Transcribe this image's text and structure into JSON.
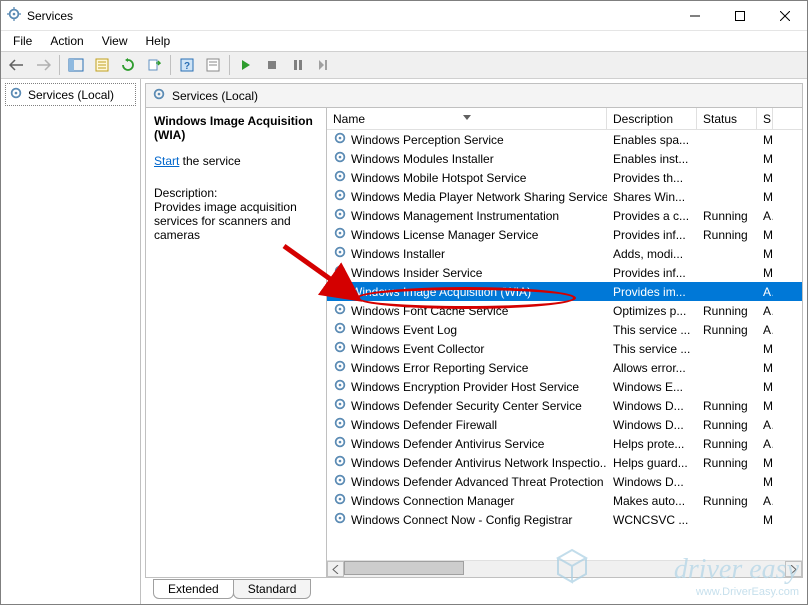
{
  "window": {
    "title": "Services"
  },
  "menu": {
    "file": "File",
    "action": "Action",
    "view": "View",
    "help": "Help"
  },
  "tree": {
    "root": "Services (Local)"
  },
  "contentHeader": "Services (Local)",
  "detail": {
    "selectedName": "Windows Image Acquisition (WIA)",
    "startLink": "Start",
    "startSuffix": " the service",
    "descLabel": "Description:",
    "descText": "Provides image acquisition services for scanners and cameras"
  },
  "columns": {
    "name": "Name",
    "description": "Description",
    "status": "Status",
    "s": "S"
  },
  "tabs": {
    "extended": "Extended",
    "standard": "Standard"
  },
  "services": [
    {
      "name": "Windows Perception Service",
      "desc": "Enables spa...",
      "status": "",
      "s": "M"
    },
    {
      "name": "Windows Modules Installer",
      "desc": "Enables inst...",
      "status": "",
      "s": "M"
    },
    {
      "name": "Windows Mobile Hotspot Service",
      "desc": "Provides th...",
      "status": "",
      "s": "M"
    },
    {
      "name": "Windows Media Player Network Sharing Service",
      "desc": "Shares Win...",
      "status": "",
      "s": "M"
    },
    {
      "name": "Windows Management Instrumentation",
      "desc": "Provides a c...",
      "status": "Running",
      "s": "A"
    },
    {
      "name": "Windows License Manager Service",
      "desc": "Provides inf...",
      "status": "Running",
      "s": "M"
    },
    {
      "name": "Windows Installer",
      "desc": "Adds, modi...",
      "status": "",
      "s": "M"
    },
    {
      "name": "Windows Insider Service",
      "desc": "Provides inf...",
      "status": "",
      "s": "M"
    },
    {
      "name": "Windows Image Acquisition (WIA)",
      "desc": "Provides im...",
      "status": "",
      "s": "A",
      "selected": true
    },
    {
      "name": "Windows Font Cache Service",
      "desc": "Optimizes p...",
      "status": "Running",
      "s": "A"
    },
    {
      "name": "Windows Event Log",
      "desc": "This service ...",
      "status": "Running",
      "s": "A"
    },
    {
      "name": "Windows Event Collector",
      "desc": "This service ...",
      "status": "",
      "s": "M"
    },
    {
      "name": "Windows Error Reporting Service",
      "desc": "Allows error...",
      "status": "",
      "s": "M"
    },
    {
      "name": "Windows Encryption Provider Host Service",
      "desc": "Windows E...",
      "status": "",
      "s": "M"
    },
    {
      "name": "Windows Defender Security Center Service",
      "desc": "Windows D...",
      "status": "Running",
      "s": "M"
    },
    {
      "name": "Windows Defender Firewall",
      "desc": "Windows D...",
      "status": "Running",
      "s": "A"
    },
    {
      "name": "Windows Defender Antivirus Service",
      "desc": "Helps prote...",
      "status": "Running",
      "s": "A"
    },
    {
      "name": "Windows Defender Antivirus Network Inspectio...",
      "desc": "Helps guard...",
      "status": "Running",
      "s": "M"
    },
    {
      "name": "Windows Defender Advanced Threat Protection ...",
      "desc": "Windows D...",
      "status": "",
      "s": "M"
    },
    {
      "name": "Windows Connection Manager",
      "desc": "Makes auto...",
      "status": "Running",
      "s": "A"
    },
    {
      "name": "Windows Connect Now - Config Registrar",
      "desc": "WCNCSVC ...",
      "status": "",
      "s": "M"
    }
  ],
  "watermark": {
    "line1": "driver easy",
    "line2": "www.DriverEasy.com"
  }
}
